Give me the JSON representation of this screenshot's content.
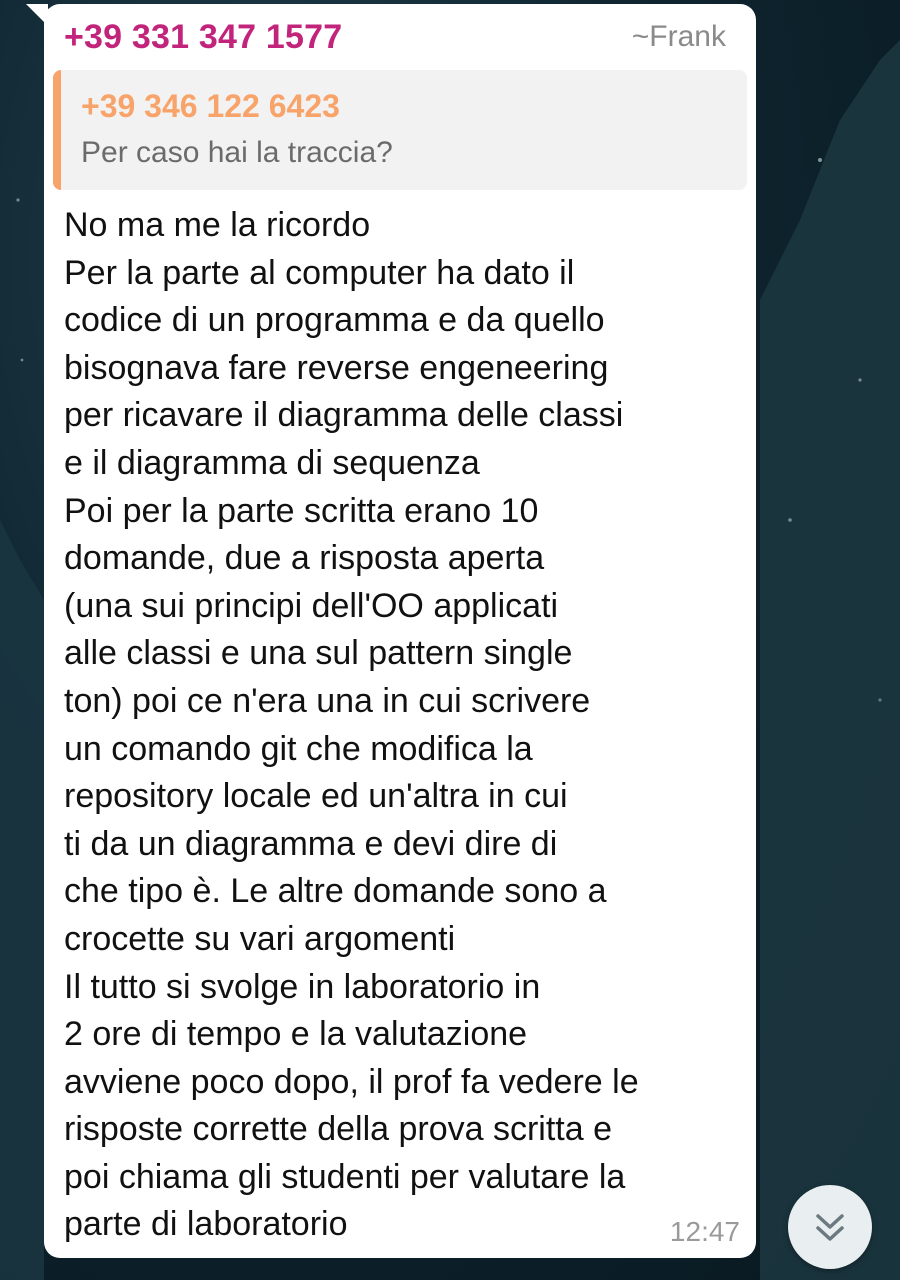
{
  "message": {
    "sender_phone": "+39 331 347 1577",
    "sender_name": "~Frank",
    "reply": {
      "phone": "+39 346 122 6423",
      "text": "Per caso hai la traccia?"
    },
    "lines": [
      "No ma me la ricordo",
      "Per la parte al computer ha dato il",
      "codice di un programma e da quello",
      "bisognava fare reverse engeneering",
      "per ricavare il diagramma delle classi",
      "e il diagramma di sequenza",
      "Poi per la parte scritta erano 10",
      "domande, due a risposta aperta",
      "(una sui principi dell'OO applicati",
      "alle classi e una sul pattern single",
      "ton) poi ce n'era una in cui scrivere",
      "un comando git che modifica la",
      "repository locale ed un'altra in cui",
      "ti da un diagramma e devi dire di",
      "che tipo è. Le altre domande sono a",
      "crocette su vari argomenti",
      "Il tutto si svolge in laboratorio in",
      "2 ore di tempo e la valutazione",
      "avviene poco dopo, il prof fa vedere le",
      "risposte corrette della prova scritta e",
      "poi chiama gli studenti per valutare la",
      "parte di laboratorio"
    ],
    "time": "12:47"
  },
  "scroll_button": {
    "icon": "double-chevron-down-icon"
  },
  "colors": {
    "sender": "#c2247c",
    "reply_accent": "#f7a36a",
    "bubble": "#ffffff",
    "wallpaper": "#0f2530"
  }
}
